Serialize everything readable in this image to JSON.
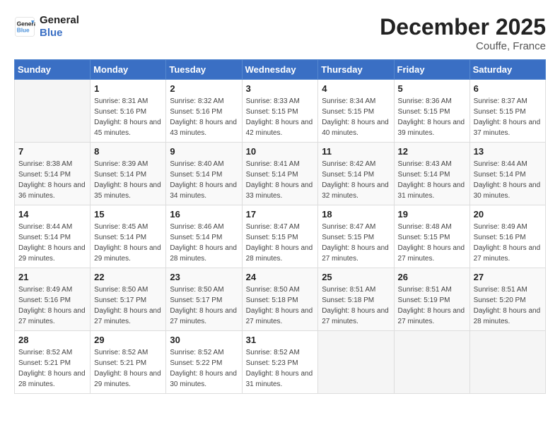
{
  "header": {
    "logo_line1": "General",
    "logo_line2": "Blue",
    "month_title": "December 2025",
    "location": "Couffe, France"
  },
  "weekdays": [
    "Sunday",
    "Monday",
    "Tuesday",
    "Wednesday",
    "Thursday",
    "Friday",
    "Saturday"
  ],
  "weeks": [
    [
      {
        "day": "",
        "sunrise": "",
        "sunset": "",
        "daylight": ""
      },
      {
        "day": "1",
        "sunrise": "Sunrise: 8:31 AM",
        "sunset": "Sunset: 5:16 PM",
        "daylight": "Daylight: 8 hours and 45 minutes."
      },
      {
        "day": "2",
        "sunrise": "Sunrise: 8:32 AM",
        "sunset": "Sunset: 5:16 PM",
        "daylight": "Daylight: 8 hours and 43 minutes."
      },
      {
        "day": "3",
        "sunrise": "Sunrise: 8:33 AM",
        "sunset": "Sunset: 5:15 PM",
        "daylight": "Daylight: 8 hours and 42 minutes."
      },
      {
        "day": "4",
        "sunrise": "Sunrise: 8:34 AM",
        "sunset": "Sunset: 5:15 PM",
        "daylight": "Daylight: 8 hours and 40 minutes."
      },
      {
        "day": "5",
        "sunrise": "Sunrise: 8:36 AM",
        "sunset": "Sunset: 5:15 PM",
        "daylight": "Daylight: 8 hours and 39 minutes."
      },
      {
        "day": "6",
        "sunrise": "Sunrise: 8:37 AM",
        "sunset": "Sunset: 5:15 PM",
        "daylight": "Daylight: 8 hours and 37 minutes."
      }
    ],
    [
      {
        "day": "7",
        "sunrise": "Sunrise: 8:38 AM",
        "sunset": "Sunset: 5:14 PM",
        "daylight": "Daylight: 8 hours and 36 minutes."
      },
      {
        "day": "8",
        "sunrise": "Sunrise: 8:39 AM",
        "sunset": "Sunset: 5:14 PM",
        "daylight": "Daylight: 8 hours and 35 minutes."
      },
      {
        "day": "9",
        "sunrise": "Sunrise: 8:40 AM",
        "sunset": "Sunset: 5:14 PM",
        "daylight": "Daylight: 8 hours and 34 minutes."
      },
      {
        "day": "10",
        "sunrise": "Sunrise: 8:41 AM",
        "sunset": "Sunset: 5:14 PM",
        "daylight": "Daylight: 8 hours and 33 minutes."
      },
      {
        "day": "11",
        "sunrise": "Sunrise: 8:42 AM",
        "sunset": "Sunset: 5:14 PM",
        "daylight": "Daylight: 8 hours and 32 minutes."
      },
      {
        "day": "12",
        "sunrise": "Sunrise: 8:43 AM",
        "sunset": "Sunset: 5:14 PM",
        "daylight": "Daylight: 8 hours and 31 minutes."
      },
      {
        "day": "13",
        "sunrise": "Sunrise: 8:44 AM",
        "sunset": "Sunset: 5:14 PM",
        "daylight": "Daylight: 8 hours and 30 minutes."
      }
    ],
    [
      {
        "day": "14",
        "sunrise": "Sunrise: 8:44 AM",
        "sunset": "Sunset: 5:14 PM",
        "daylight": "Daylight: 8 hours and 29 minutes."
      },
      {
        "day": "15",
        "sunrise": "Sunrise: 8:45 AM",
        "sunset": "Sunset: 5:14 PM",
        "daylight": "Daylight: 8 hours and 29 minutes."
      },
      {
        "day": "16",
        "sunrise": "Sunrise: 8:46 AM",
        "sunset": "Sunset: 5:14 PM",
        "daylight": "Daylight: 8 hours and 28 minutes."
      },
      {
        "day": "17",
        "sunrise": "Sunrise: 8:47 AM",
        "sunset": "Sunset: 5:15 PM",
        "daylight": "Daylight: 8 hours and 28 minutes."
      },
      {
        "day": "18",
        "sunrise": "Sunrise: 8:47 AM",
        "sunset": "Sunset: 5:15 PM",
        "daylight": "Daylight: 8 hours and 27 minutes."
      },
      {
        "day": "19",
        "sunrise": "Sunrise: 8:48 AM",
        "sunset": "Sunset: 5:15 PM",
        "daylight": "Daylight: 8 hours and 27 minutes."
      },
      {
        "day": "20",
        "sunrise": "Sunrise: 8:49 AM",
        "sunset": "Sunset: 5:16 PM",
        "daylight": "Daylight: 8 hours and 27 minutes."
      }
    ],
    [
      {
        "day": "21",
        "sunrise": "Sunrise: 8:49 AM",
        "sunset": "Sunset: 5:16 PM",
        "daylight": "Daylight: 8 hours and 27 minutes."
      },
      {
        "day": "22",
        "sunrise": "Sunrise: 8:50 AM",
        "sunset": "Sunset: 5:17 PM",
        "daylight": "Daylight: 8 hours and 27 minutes."
      },
      {
        "day": "23",
        "sunrise": "Sunrise: 8:50 AM",
        "sunset": "Sunset: 5:17 PM",
        "daylight": "Daylight: 8 hours and 27 minutes."
      },
      {
        "day": "24",
        "sunrise": "Sunrise: 8:50 AM",
        "sunset": "Sunset: 5:18 PM",
        "daylight": "Daylight: 8 hours and 27 minutes."
      },
      {
        "day": "25",
        "sunrise": "Sunrise: 8:51 AM",
        "sunset": "Sunset: 5:18 PM",
        "daylight": "Daylight: 8 hours and 27 minutes."
      },
      {
        "day": "26",
        "sunrise": "Sunrise: 8:51 AM",
        "sunset": "Sunset: 5:19 PM",
        "daylight": "Daylight: 8 hours and 27 minutes."
      },
      {
        "day": "27",
        "sunrise": "Sunrise: 8:51 AM",
        "sunset": "Sunset: 5:20 PM",
        "daylight": "Daylight: 8 hours and 28 minutes."
      }
    ],
    [
      {
        "day": "28",
        "sunrise": "Sunrise: 8:52 AM",
        "sunset": "Sunset: 5:21 PM",
        "daylight": "Daylight: 8 hours and 28 minutes."
      },
      {
        "day": "29",
        "sunrise": "Sunrise: 8:52 AM",
        "sunset": "Sunset: 5:21 PM",
        "daylight": "Daylight: 8 hours and 29 minutes."
      },
      {
        "day": "30",
        "sunrise": "Sunrise: 8:52 AM",
        "sunset": "Sunset: 5:22 PM",
        "daylight": "Daylight: 8 hours and 30 minutes."
      },
      {
        "day": "31",
        "sunrise": "Sunrise: 8:52 AM",
        "sunset": "Sunset: 5:23 PM",
        "daylight": "Daylight: 8 hours and 31 minutes."
      },
      {
        "day": "",
        "sunrise": "",
        "sunset": "",
        "daylight": ""
      },
      {
        "day": "",
        "sunrise": "",
        "sunset": "",
        "daylight": ""
      },
      {
        "day": "",
        "sunrise": "",
        "sunset": "",
        "daylight": ""
      }
    ]
  ]
}
